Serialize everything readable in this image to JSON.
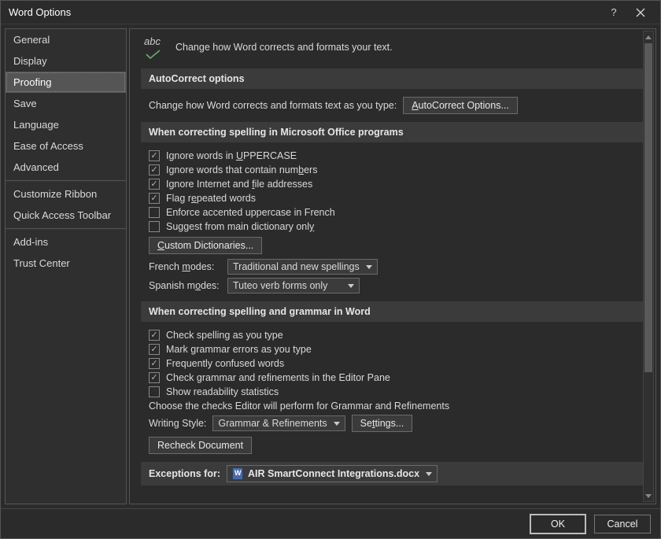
{
  "title": "Word Options",
  "sidebar": {
    "items": [
      {
        "label": "General"
      },
      {
        "label": "Display"
      },
      {
        "label": "Proofing",
        "selected": true
      },
      {
        "label": "Save"
      },
      {
        "label": "Language"
      },
      {
        "label": "Ease of Access"
      },
      {
        "label": "Advanced"
      }
    ],
    "items2": [
      {
        "label": "Customize Ribbon"
      },
      {
        "label": "Quick Access Toolbar"
      }
    ],
    "items3": [
      {
        "label": "Add-ins"
      },
      {
        "label": "Trust Center"
      }
    ]
  },
  "header": {
    "icon_text": "abc",
    "desc": "Change how Word corrects and formats your text."
  },
  "sections": {
    "autocorrect": {
      "title": "AutoCorrect options",
      "desc": "Change how Word corrects and formats text as you type:",
      "button_pre": "A",
      "button_text": "utoCorrect Options..."
    },
    "office_spelling": {
      "title": "When correcting spelling in Microsoft Office programs",
      "checks": [
        {
          "checked": true,
          "pre": "Ignore words in ",
          "ul": "U",
          "post": "PPERCASE"
        },
        {
          "checked": true,
          "pre": "Ignore words that contain num",
          "ul": "b",
          "post": "ers"
        },
        {
          "checked": true,
          "pre": "Ignore Internet and ",
          "ul": "f",
          "post": "ile addresses"
        },
        {
          "checked": true,
          "pre": "Flag r",
          "ul": "e",
          "post": "peated words"
        },
        {
          "checked": false,
          "pre": "Enforce accented uppercase in French",
          "ul": "",
          "post": ""
        },
        {
          "checked": false,
          "pre": "Suggest from main dictionary onl",
          "ul": "y",
          "post": ""
        }
      ],
      "custom_dict_pre": "C",
      "custom_dict_text": "ustom Dictionaries...",
      "french_label_pre": "French ",
      "french_label_ul": "m",
      "french_label_post": "odes:",
      "french_value": "Traditional and new spellings",
      "spanish_label_pre": "Spanish m",
      "spanish_label_ul": "o",
      "spanish_label_post": "des:",
      "spanish_value": "Tuteo verb forms only"
    },
    "word_spelling": {
      "title": "When correcting spelling and grammar in Word",
      "checks": [
        {
          "checked": true,
          "text": "Check spelling as you type"
        },
        {
          "checked": true,
          "text": "Mark grammar errors as you type"
        },
        {
          "checked": true,
          "text": "Frequently confused words"
        },
        {
          "checked": true,
          "text": "Check grammar and refinements in the Editor Pane"
        },
        {
          "checked": false,
          "text": "Show readability statistics"
        }
      ],
      "choose_text": "Choose the checks Editor will perform for Grammar and Refinements",
      "writing_style_label_pre": "Writin",
      "writing_style_label_ul": "g",
      "writing_style_label_post": " Style:",
      "writing_style_value": "Grammar & Refinements",
      "settings_pre": "Se",
      "settings_ul": "t",
      "settings_post": "tings...",
      "recheck": "Recheck Document"
    },
    "exceptions": {
      "label": "Exceptions for:",
      "doc": "AIR SmartConnect Integrations.docx"
    }
  },
  "footer": {
    "ok": "OK",
    "cancel": "Cancel"
  }
}
